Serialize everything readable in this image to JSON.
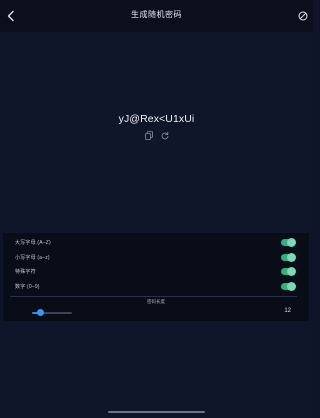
{
  "header": {
    "title": "生成随机密码",
    "back_icon": "chevron-left-icon",
    "action_icon": "circle-slash-icon"
  },
  "password": {
    "value": "yJ@Rex<U1xUi",
    "copy_icon": "copy-icon",
    "refresh_icon": "refresh-icon"
  },
  "options": [
    {
      "label": "大写字母 (A–Z)",
      "enabled": true
    },
    {
      "label": "小写字母 (a–z)",
      "enabled": true
    },
    {
      "label": "特殊字符",
      "enabled": true
    },
    {
      "label": "数字 (0–9)",
      "enabled": true
    }
  ],
  "length": {
    "label": "密码长度",
    "value": "12",
    "slider_fraction": 0.22
  },
  "colors": {
    "background": "#101629",
    "toggle_on": "#2fb07e",
    "slider": "#2d8be4"
  }
}
